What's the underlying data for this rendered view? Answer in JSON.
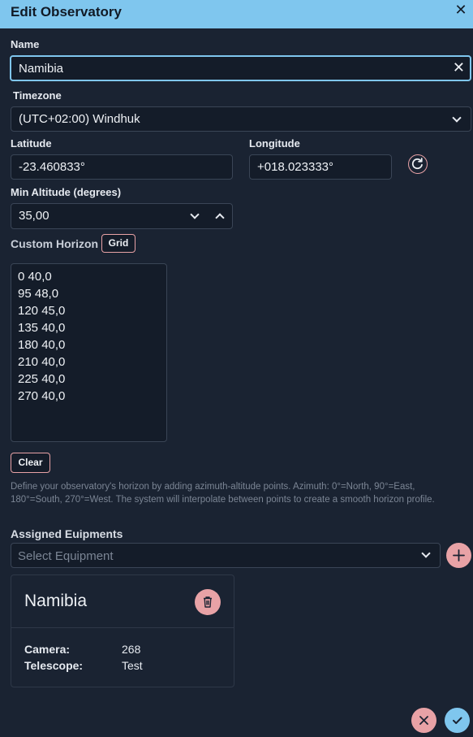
{
  "dialog": {
    "title": "Edit Observatory"
  },
  "name": {
    "label": "Name",
    "value": "Namibia"
  },
  "timezone": {
    "label": "Timezone",
    "value": "(UTC+02:00) Windhuk"
  },
  "latitude": {
    "label": "Latitude",
    "value": "-23.460833°"
  },
  "longitude": {
    "label": "Longitude",
    "value": "+018.023333°"
  },
  "min_altitude": {
    "label": "Min Altitude (degrees)",
    "value": "35,00"
  },
  "custom_horizon": {
    "label": "Custom Horizon",
    "grid_label": "Grid",
    "points": [
      "0 40,0",
      "95 48,0",
      "120 45,0",
      "135 40,0",
      "180 40,0",
      "210 40,0",
      "225 40,0",
      "270 40,0"
    ],
    "clear_label": "Clear",
    "help": "Define your observatory's horizon by adding azimuth-altitude points. Azimuth: 0°=North, 90°=East, 180°=South, 270°=West. The system will interpolate between points to create a smooth horizon profile."
  },
  "equipment": {
    "title": "Assigned Euipments",
    "select_placeholder": "Select Equipment",
    "card": {
      "title": "Namibia",
      "rows": [
        {
          "key": "Camera:",
          "value": "268"
        },
        {
          "key": "Telescope:",
          "value": "Test"
        }
      ]
    }
  },
  "colors": {
    "header": "#7fc6ee",
    "background": "#1a2332",
    "danger": "#e8a2a6",
    "confirm": "#7fc6ee"
  },
  "icons": {
    "close": "close-icon",
    "refresh": "refresh-icon",
    "trash": "trash-icon",
    "add": "plus-icon",
    "cancel": "x-icon",
    "confirm": "check-icon"
  }
}
